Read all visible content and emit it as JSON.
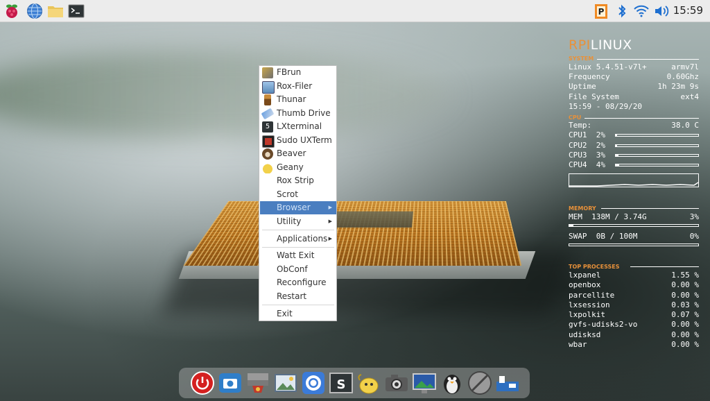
{
  "panel": {
    "clock": "15:59",
    "launchers": [
      {
        "icon": "raspberry-pi-icon"
      },
      {
        "icon": "globe-browser-icon"
      },
      {
        "icon": "folder-icon"
      },
      {
        "icon": "terminal-icon"
      }
    ],
    "tray": [
      {
        "icon": "parcellite-clipboard-icon"
      },
      {
        "icon": "bluetooth-icon"
      },
      {
        "icon": "wifi-icon"
      },
      {
        "icon": "volume-icon"
      }
    ]
  },
  "menu": {
    "items": [
      {
        "label": "FBrun",
        "icon": "fbrun-icon"
      },
      {
        "label": "Rox-Filer",
        "icon": "rox-filer-icon"
      },
      {
        "label": "Thunar",
        "icon": "thunar-icon"
      },
      {
        "label": "Thumb Drive",
        "icon": "thumb-drive-icon"
      },
      {
        "label": "LXterminal",
        "icon": "lxterminal-icon"
      },
      {
        "label": "Sudo UXTerm",
        "icon": "uxterm-icon"
      },
      {
        "label": "Beaver",
        "icon": "beaver-icon"
      },
      {
        "label": "Geany",
        "icon": "geany-icon"
      },
      {
        "label": "Rox Strip"
      },
      {
        "label": "Scrot"
      },
      {
        "label": "Browser",
        "submenu": true,
        "selected": true
      },
      {
        "label": "Utility",
        "submenu": true
      },
      {
        "label": "Applications",
        "submenu": true
      },
      {
        "label": "Watt Exit"
      },
      {
        "label": "ObConf"
      },
      {
        "label": "Reconfigure"
      },
      {
        "label": "Restart"
      },
      {
        "label": "Exit"
      }
    ]
  },
  "conky": {
    "brand_a": "RPI",
    "brand_b": "LINUX",
    "system": {
      "heading": "SYSTEM",
      "kernel_label": "Linux 5.4.51-v7l+",
      "kernel_value": "armv7l",
      "freq_label": "Frequency",
      "freq_value": "0.60Ghz",
      "uptime_label": "Uptime",
      "uptime_value": "1h 23m 9s",
      "fs_label": "File System",
      "fs_value": "ext4",
      "datetime": "15:59 - 08/29/20"
    },
    "cpu": {
      "heading": "CPU",
      "temp_label": "Temp:",
      "temp_value": "38.0 C",
      "cores": [
        {
          "label": "CPU1",
          "value": "2%",
          "level": 0.02
        },
        {
          "label": "CPU2",
          "value": "2%",
          "level": 0.02
        },
        {
          "label": "CPU3",
          "value": "3%",
          "level": 0.03
        },
        {
          "label": "CPU4",
          "value": "4%",
          "level": 0.04
        }
      ]
    },
    "memory": {
      "heading": "MEMORY",
      "mem_label": "MEM  138M / 3.74G",
      "mem_value": "3%",
      "mem_level": 0.03,
      "swap_label": "SWAP  0B / 100M",
      "swap_value": "0%",
      "swap_level": 0.0
    },
    "processes": {
      "heading": "TOP PROCESSES",
      "list": [
        {
          "name": "lxpanel",
          "value": "1.55 %"
        },
        {
          "name": "openbox",
          "value": "0.00 %"
        },
        {
          "name": "parcellite",
          "value": "0.00 %"
        },
        {
          "name": "lxsession",
          "value": "0.03 %"
        },
        {
          "name": "lxpolkit",
          "value": "0.07 %"
        },
        {
          "name": "gvfs-udisks2-vo",
          "value": "0.00 %"
        },
        {
          "name": "udisksd",
          "value": "0.00 %"
        },
        {
          "name": "wbar",
          "value": "0.00 %"
        }
      ]
    }
  },
  "dock": {
    "items": [
      {
        "icon": "power-icon"
      },
      {
        "icon": "screenshot-camera-icon"
      },
      {
        "icon": "file-manager-drawer-icon"
      },
      {
        "icon": "image-viewer-icon"
      },
      {
        "icon": "chromium-icon"
      },
      {
        "icon": "terminal-icon"
      },
      {
        "icon": "geany-icon"
      },
      {
        "icon": "camera-icon"
      },
      {
        "icon": "display-settings-icon"
      },
      {
        "icon": "penguin-icon"
      },
      {
        "icon": "no-entry-icon"
      },
      {
        "icon": "network-device-icon"
      }
    ]
  }
}
